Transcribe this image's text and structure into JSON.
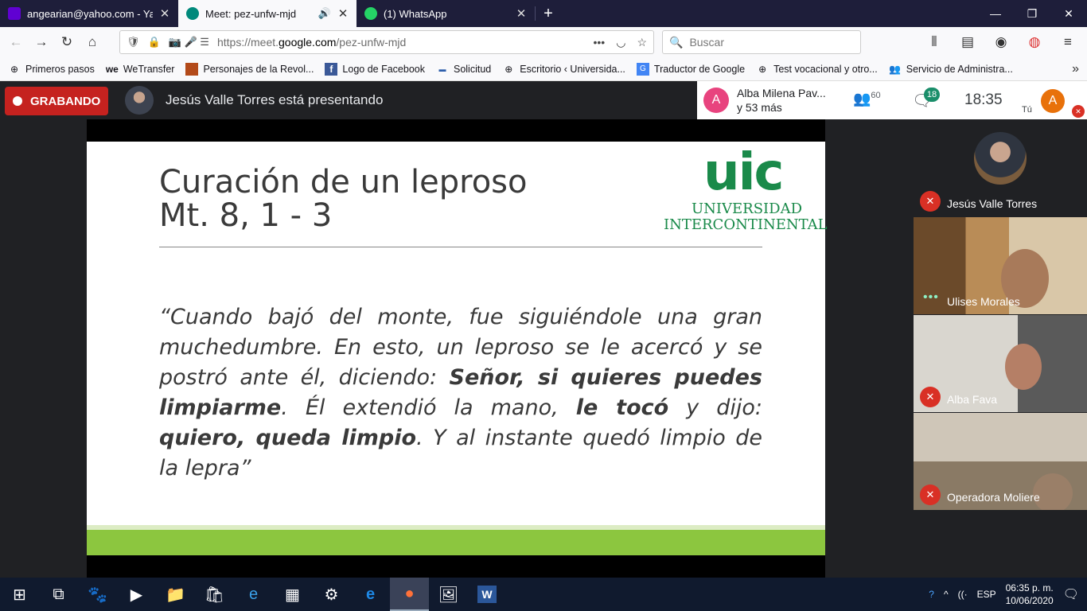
{
  "browser": {
    "tabs": [
      {
        "title": "angearian@yahoo.com - Yahoo",
        "icon": "yahoo-mail-icon",
        "color": "#6001d2"
      },
      {
        "title": "Meet: pez-unfw-mjd",
        "icon": "meet-icon",
        "color": "#00897b",
        "active": true
      },
      {
        "title": "(1) WhatsApp",
        "icon": "whatsapp-icon",
        "color": "#25d366"
      }
    ],
    "url_prefix": "https://meet.",
    "url_host": "google.com",
    "url_path": "/pez-unfw-mjd",
    "search_placeholder": "Buscar",
    "bookmarks": [
      "Primeros pasos",
      "WeTransfer",
      "Personajes de la Revol...",
      "Logo de Facebook",
      "Solicitud",
      "Escritorio ‹ Universida...",
      "Traductor de Google",
      "Test vocacional y otro...",
      "Servicio de Administra..."
    ]
  },
  "meet": {
    "recording_label": "GRABANDO",
    "presenting_text": "Jesús Valle Torres está presentando",
    "people_summary_line1": "Alba Milena Pav...",
    "people_summary_line2": "y 53 más",
    "people_avatar_letter": "A",
    "participant_count": "60",
    "chat_count": "18",
    "clock": "18:35",
    "self_label": "Tú",
    "self_avatar_letter": "A",
    "participants": [
      {
        "name": "Jesús Valle Torres",
        "muted": true
      },
      {
        "name": "Ulises Morales",
        "muted": false
      },
      {
        "name": "Alba Fava",
        "muted": true
      },
      {
        "name": "Operadora Moliere",
        "muted": true
      }
    ]
  },
  "slide": {
    "title_line1": "Curación de un leproso",
    "title_line2": "Mt. 8, 1 - 3",
    "logo_short": "uic",
    "logo_line1": "UNIVERSIDAD",
    "logo_line2": "INTERCONTINENTAL",
    "quote_parts": [
      {
        "text": "“Cuando bajó del monte, fue siguiéndole una gran muchedumbre. En esto, un leproso se le acercó y se postró ante él, diciendo: ",
        "bold": false
      },
      {
        "text": "Señor, si quieres puedes limpiarme",
        "bold": true
      },
      {
        "text": ". Él extendió la mano, ",
        "bold": false
      },
      {
        "text": "le tocó",
        "bold": true
      },
      {
        "text": " y dijo: ",
        "bold": false
      },
      {
        "text": "quiero, queda limpio",
        "bold": true
      },
      {
        "text": ". Y al instante quedó limpio de la lepra”",
        "bold": false
      }
    ]
  },
  "taskbar": {
    "language": "ESP",
    "time": "06:35 p. m.",
    "date": "10/06/2020"
  }
}
